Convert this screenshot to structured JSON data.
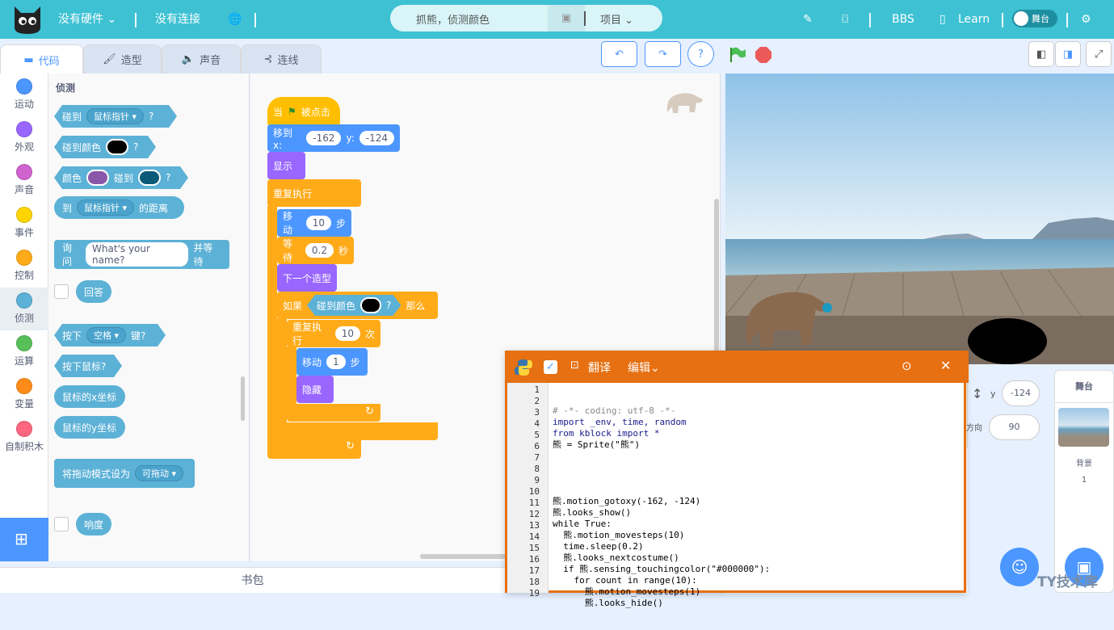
{
  "topbar": {
    "hardware": "没有硬件",
    "connection": "没有连接",
    "project_name": "抓熊，侦测颜色",
    "project_menu": "项目",
    "bbs": "BBS",
    "learn": "Learn",
    "stage_toggle": "舞台"
  },
  "tabs": [
    {
      "label": "代码"
    },
    {
      "label": "造型"
    },
    {
      "label": "声音"
    },
    {
      "label": "连线"
    }
  ],
  "categories": [
    {
      "label": "运动",
      "color": "#4c97ff"
    },
    {
      "label": "外观",
      "color": "#9966ff"
    },
    {
      "label": "声音",
      "color": "#cf63cf"
    },
    {
      "label": "事件",
      "color": "#ffd500"
    },
    {
      "label": "控制",
      "color": "#ffab19"
    },
    {
      "label": "侦测",
      "color": "#5cb1d6"
    },
    {
      "label": "运算",
      "color": "#59c059"
    },
    {
      "label": "变量",
      "color": "#ff8c1a"
    },
    {
      "label": "自制积木",
      "color": "#ff6680"
    }
  ],
  "palette": {
    "heading": "侦测",
    "touching": "碰到",
    "mouse_pointer": "鼠标指针",
    "q": "?",
    "touching_color": "碰到颜色",
    "color": "颜色",
    "touch": "碰到",
    "distance_to": "到",
    "distance_suffix": "的距离",
    "ask": "询问",
    "ask_default": "What's your name?",
    "ask_wait": "并等待",
    "answer": "回答",
    "key_pressed": "按下",
    "key_space": "空格",
    "key_suffix": "键?",
    "mouse_down": "按下鼠标?",
    "mouse_x": "鼠标的x坐标",
    "mouse_y": "鼠标的y坐标",
    "drag_mode": "将拖动模式设为",
    "draggable": "可拖动",
    "loudness": "响度"
  },
  "script": {
    "when_flag": "当",
    "clicked": "被点击",
    "goto": "移到 x:",
    "x": "-162",
    "y_label": "y:",
    "y": "-124",
    "show": "显示",
    "forever": "重复执行",
    "move": "移动",
    "steps": "10",
    "step_unit": "步",
    "wait": "等待",
    "wait_val": "0.2",
    "sec": "秒",
    "next_costume": "下一个造型",
    "if": "如果",
    "touching_color": "碰到颜色",
    "q": "?",
    "then": "那么",
    "repeat": "重复执行",
    "repeat_val": "10",
    "times": "次",
    "move2": "移动",
    "move2_val": "1",
    "step2": "步",
    "hide": "隐藏"
  },
  "python": {
    "translate": "翻译",
    "edit": "编辑",
    "lines": [
      "# -*- coding: utf-8 -*-",
      "import _env, time, random",
      "from kblock import *",
      "熊 = Sprite(\"熊\")",
      "",
      "",
      "",
      "",
      "熊.motion_gotoxy(-162, -124)",
      "熊.looks_show()",
      "while True:",
      "  熊.motion_movesteps(10)",
      "  time.sleep(0.2)",
      "  熊.looks_nextcostume()",
      "  if 熊.sensing_touchingcolor(\"#000000\"):",
      "    for count in range(10):",
      "      熊.motion_movesteps(1)",
      "      熊.looks_hide()"
    ],
    "numbers": [
      "1",
      "2",
      "3",
      "4",
      "5",
      "6",
      "7",
      "8",
      "9",
      "10",
      "11",
      "12",
      "13",
      "14",
      "15",
      "16",
      "17",
      "18",
      "19"
    ]
  },
  "sprite_info": {
    "y_label": "y",
    "y_value": "-124",
    "dir_label": "方向",
    "dir_value": "90"
  },
  "stage_panel": {
    "title": "舞台",
    "backdrop_label": "背景",
    "backdrop_count": "1"
  },
  "bag": "书包",
  "watermark": "TY技术库"
}
